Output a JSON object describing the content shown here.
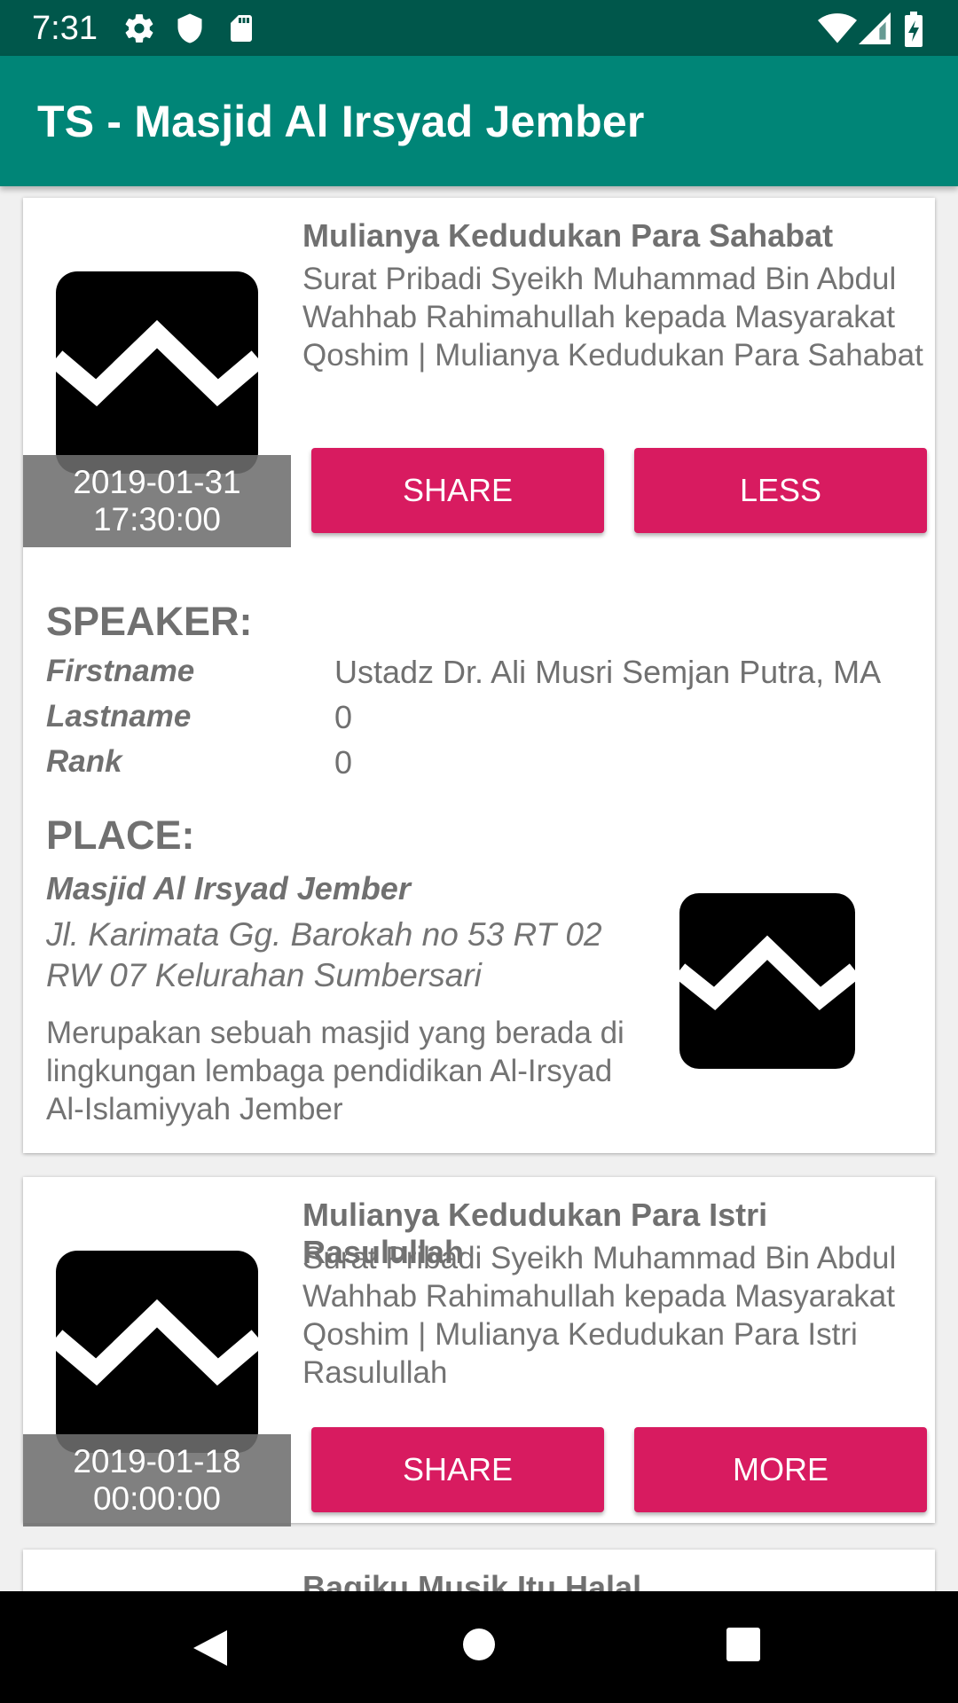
{
  "status_bar": {
    "time": "7:31",
    "icons": [
      "gear-icon",
      "shield-icon",
      "sd-card-icon",
      "wifi-icon",
      "signal-icon",
      "battery-icon"
    ]
  },
  "app_bar": {
    "title": "TS - Masjid Al Irsyad Jember"
  },
  "colors": {
    "primary": "#008577",
    "primary_dark": "#00574b",
    "accent": "#d81b60"
  },
  "cards": [
    {
      "date": "2019-01-31",
      "time": "17:30:00",
      "title": "Mulianya Kedudukan Para Sahabat",
      "description": "Surat Pribadi Syeikh Muhammad Bin Abdul Wahhab Rahimahullah kepada Masyarakat Qoshim | Mulianya Kedudukan Para Sahabat",
      "share_label": "SHARE",
      "toggle_label": "LESS",
      "expanded": true,
      "speaker": {
        "heading": "SPEAKER:",
        "fields": [
          {
            "key": "Firstname",
            "value": "Ustadz Dr. Ali Musri Semjan Putra, MA"
          },
          {
            "key": "Lastname",
            "value": "0"
          },
          {
            "key": "Rank",
            "value": "0"
          }
        ]
      },
      "place": {
        "heading": "PLACE:",
        "name": "Masjid Al Irsyad Jember",
        "address": "Jl. Karimata Gg. Barokah no 53 RT 02 RW 07 Kelurahan Sumbersari",
        "description": "Merupakan sebuah masjid yang berada di lingkungan lembaga pendidikan Al-Irsyad Al-Islamiyyah Jember"
      }
    },
    {
      "date": "2019-01-18",
      "time": "00:00:00",
      "title": "Mulianya Kedudukan Para Istri Rasulullah",
      "description": "Surat Pribadi Syeikh Muhammad Bin Abdul Wahhab Rahimahullah kepada Masyarakat Qoshim | Mulianya Kedudukan Para Istri Rasulullah",
      "share_label": "SHARE",
      "toggle_label": "MORE",
      "expanded": false
    },
    {
      "title": "Bagiku Musik Itu Halal"
    }
  ],
  "nav_bar": {
    "icons": [
      "back-icon",
      "home-icon",
      "recents-icon"
    ]
  }
}
